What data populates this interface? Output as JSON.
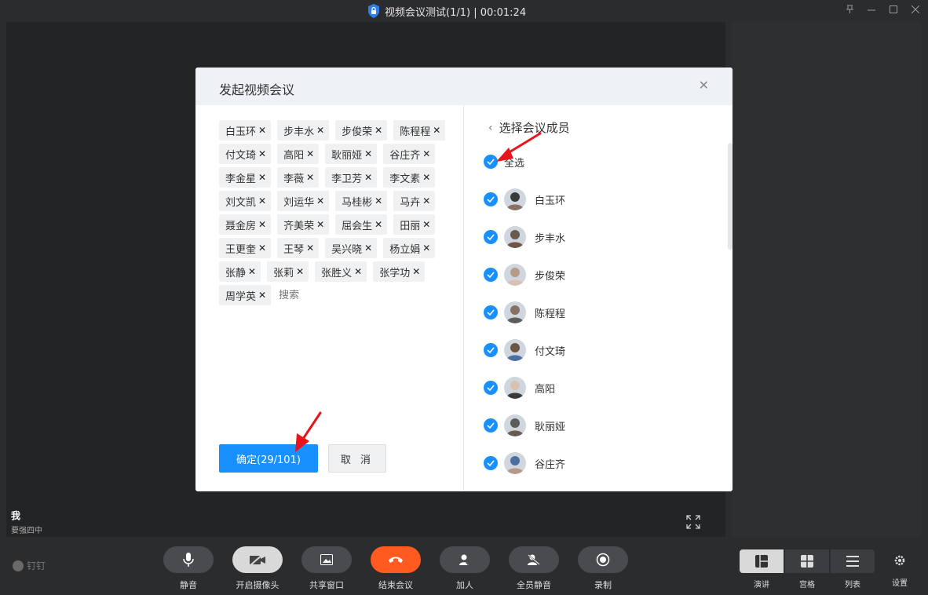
{
  "window": {
    "title": "视频会议测试(1/1) | 00:01:24",
    "controls": [
      "pin-icon",
      "minimize-icon",
      "maximize-icon",
      "close-icon"
    ]
  },
  "stage": {
    "self_name": "我",
    "self_status": "要强四中"
  },
  "dialog": {
    "title": "发起视频会议",
    "selected_chips": [
      "白玉环",
      "步丰水",
      "步俊荣",
      "陈程程",
      "付文琦",
      "高阳",
      "耿丽娅",
      "谷庄齐",
      "李金星",
      "李薇",
      "李卫芳",
      "李文素",
      "刘文凯",
      "刘运华",
      "马桂彬",
      "马卉",
      "聂金房",
      "齐美荣",
      "屈会生",
      "田丽",
      "王更奎",
      "王琴",
      "吴兴晓",
      "杨立娟",
      "张静",
      "张莉",
      "张胜义",
      "张学功",
      "周学英"
    ],
    "search_placeholder": "搜索",
    "confirm_label": "确定(29/101)",
    "cancel_label": "取 消",
    "member_panel_title": "选择会议成员",
    "select_all_label": "全选",
    "members": [
      "白玉环",
      "步丰水",
      "步俊荣",
      "陈程程",
      "付文琦",
      "高阳",
      "耿丽娅",
      "谷庄齐"
    ]
  },
  "bottombar": {
    "brand": "钉钉",
    "controls": [
      {
        "label": "静音",
        "icon": "microphone-icon"
      },
      {
        "label": "开启摄像头",
        "icon": "camera-off-icon"
      },
      {
        "label": "共享窗口",
        "icon": "share-window-icon"
      },
      {
        "label": "结束会议",
        "icon": "hangup-icon"
      },
      {
        "label": "加人",
        "icon": "add-person-icon"
      },
      {
        "label": "全员静音",
        "icon": "mute-all-icon"
      },
      {
        "label": "录制",
        "icon": "record-icon"
      }
    ],
    "layouts": [
      {
        "label": "演讲",
        "icon": "speaker-layout-icon",
        "active": true
      },
      {
        "label": "宫格",
        "icon": "grid-layout-icon",
        "active": false
      },
      {
        "label": "列表",
        "icon": "list-layout-icon",
        "active": false
      }
    ],
    "settings_label": "设置"
  },
  "colors": {
    "primary": "#1890ff",
    "end_call": "#ff5a1f",
    "annotation_arrow": "#e8141c"
  }
}
